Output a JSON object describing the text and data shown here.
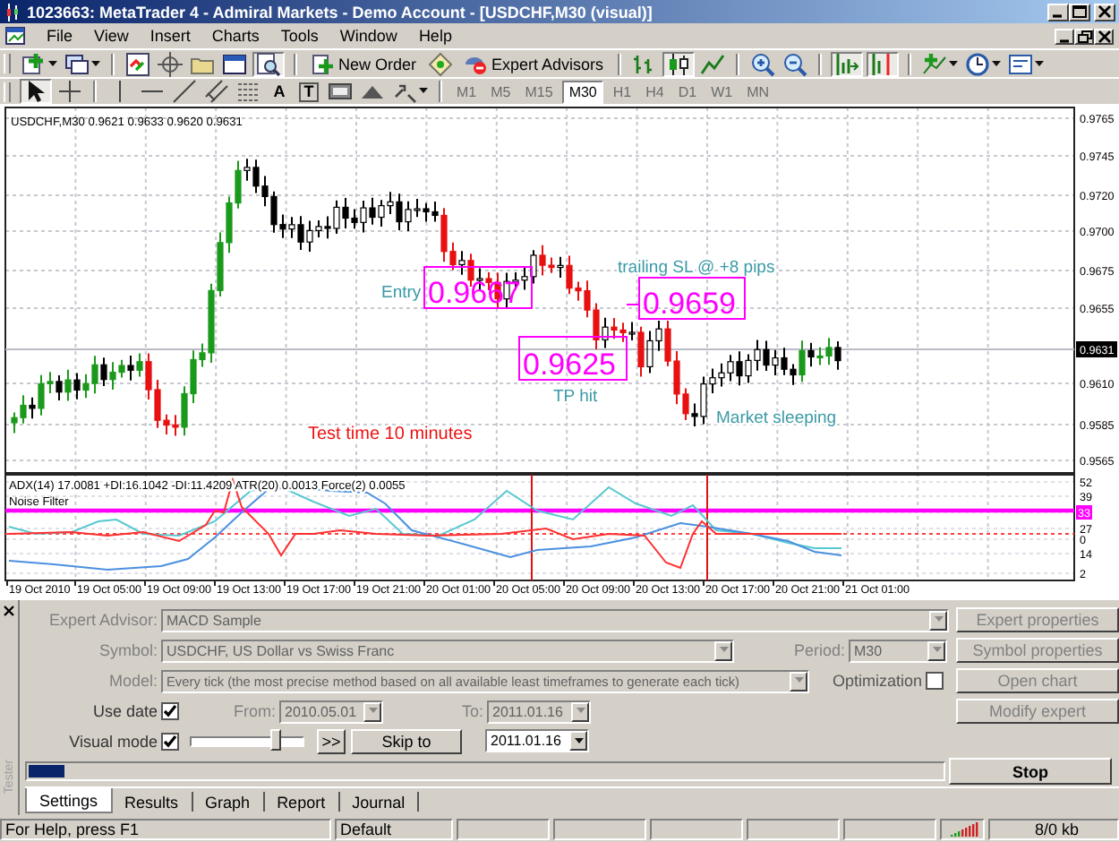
{
  "window": {
    "title": "1023663: MetaTrader 4 - Admiral Markets - Demo Account - [USDCHF,M30 (visual)]"
  },
  "menu": [
    "File",
    "View",
    "Insert",
    "Charts",
    "Tools",
    "Window",
    "Help"
  ],
  "toolbar": {
    "buttons": [
      {
        "label": "New Order"
      },
      {
        "label": "Expert Advisors"
      }
    ]
  },
  "drawing_tools": {
    "text_tools": [
      "A",
      "T"
    ]
  },
  "timeframes": [
    {
      "label": "M1",
      "selected": false
    },
    {
      "label": "M5",
      "selected": false
    },
    {
      "label": "M15",
      "selected": false
    },
    {
      "label": "M30",
      "selected": true
    },
    {
      "label": "H1",
      "selected": false
    },
    {
      "label": "H4",
      "selected": false
    },
    {
      "label": "D1",
      "selected": false
    },
    {
      "label": "W1",
      "selected": false
    },
    {
      "label": "MN",
      "selected": false
    }
  ],
  "chart": {
    "title": "USDCHF,M30  0.9621 0.9633 0.9620 0.9631",
    "price_axis": [
      {
        "label": "0.9765",
        "current": false
      },
      {
        "label": "0.9745",
        "current": false
      },
      {
        "label": "0.9720",
        "current": false
      },
      {
        "label": "0.9700",
        "current": false
      },
      {
        "label": "0.9675",
        "current": false
      },
      {
        "label": "0.9655",
        "current": false
      },
      {
        "label": "0.9631",
        "current": true
      },
      {
        "label": "0.9610",
        "current": false
      },
      {
        "label": "0.9585",
        "current": false
      },
      {
        "label": "0.9565",
        "current": false
      }
    ],
    "annotations": [
      {
        "kind": "note",
        "text": "Entry"
      },
      {
        "kind": "price",
        "text": "0.9667"
      },
      {
        "kind": "note",
        "text": "trailing SL @ +8 pips"
      },
      {
        "kind": "price",
        "text": "0.9659"
      },
      {
        "kind": "price",
        "text": "0.9625"
      },
      {
        "kind": "note",
        "text": "TP hit"
      },
      {
        "kind": "note",
        "text": "Market sleeping"
      },
      {
        "kind": "alert",
        "text": "Test time 10 minutes"
      }
    ],
    "indicator": {
      "legend": "ADX(14) 17.0081 +DI:16.1042 -DI:11.4209 ATR(20) 0.0013 Force(2) 0.0055",
      "noise_filter": "Noise Filter",
      "axis": [
        {
          "label": "52",
          "current": false
        },
        {
          "label": "39",
          "current": false
        },
        {
          "label": "33",
          "current": true
        },
        {
          "label": "27",
          "current": false
        },
        {
          "label": "0",
          "current": false
        },
        {
          "label": "14",
          "current": false
        },
        {
          "label": "2",
          "current": false
        }
      ]
    },
    "time_axis": [
      "19 Oct 2010",
      "19 Oct 05:00",
      "19 Oct 09:00",
      "19 Oct 13:00",
      "19 Oct 17:00",
      "19 Oct 21:00",
      "20 Oct 01:00",
      "20 Oct 05:00",
      "20 Oct 09:00",
      "20 Oct 13:00",
      "20 Oct 17:00",
      "20 Oct 21:00",
      "21 Oct 01:00"
    ]
  },
  "tester": {
    "title": "Tester",
    "expert_advisor": {
      "label": "Expert Advisor:",
      "value": "MACD Sample",
      "disabled": true
    },
    "symbol": {
      "label": "Symbol:",
      "value": "USDCHF, US Dollar vs Swiss Franc",
      "disabled": true
    },
    "period": {
      "label": "Period:",
      "value": "M30",
      "disabled": true
    },
    "model": {
      "label": "Model:",
      "value": "Every tick (the most precise method based on all available least timeframes to generate each tick)",
      "disabled": true
    },
    "optimization": {
      "label": "Optimization",
      "checked": false
    },
    "use_date": {
      "label": "Use date",
      "checked": true
    },
    "from": {
      "label": "From:",
      "value": "2010.05.01",
      "disabled": true
    },
    "to": {
      "label": "To:",
      "value": "2011.01.16",
      "disabled": true
    },
    "visual_mode": {
      "label": "Visual mode",
      "checked": true
    },
    "speed": {
      "level": 0.78
    },
    "fast_forward": ">>",
    "skip_to": "Skip to",
    "skip_date": {
      "value": "2011.01.16",
      "disabled": false
    },
    "progress": {
      "level": 0.04
    },
    "buttons": [
      {
        "label": "Expert properties",
        "disabled": true
      },
      {
        "label": "Symbol properties",
        "disabled": true
      },
      {
        "label": "Open chart",
        "disabled": true
      },
      {
        "label": "Modify expert",
        "disabled": true
      }
    ],
    "stop": "Stop",
    "tabs": [
      {
        "label": "Settings",
        "selected": true
      },
      {
        "label": "Results",
        "selected": false
      },
      {
        "label": "Graph",
        "selected": false
      },
      {
        "label": "Report",
        "selected": false
      },
      {
        "label": "Journal",
        "selected": false
      }
    ]
  },
  "status_bar": {
    "help": "For Help, press F1",
    "profile": "Default",
    "traffic": "8/0 kb"
  }
}
